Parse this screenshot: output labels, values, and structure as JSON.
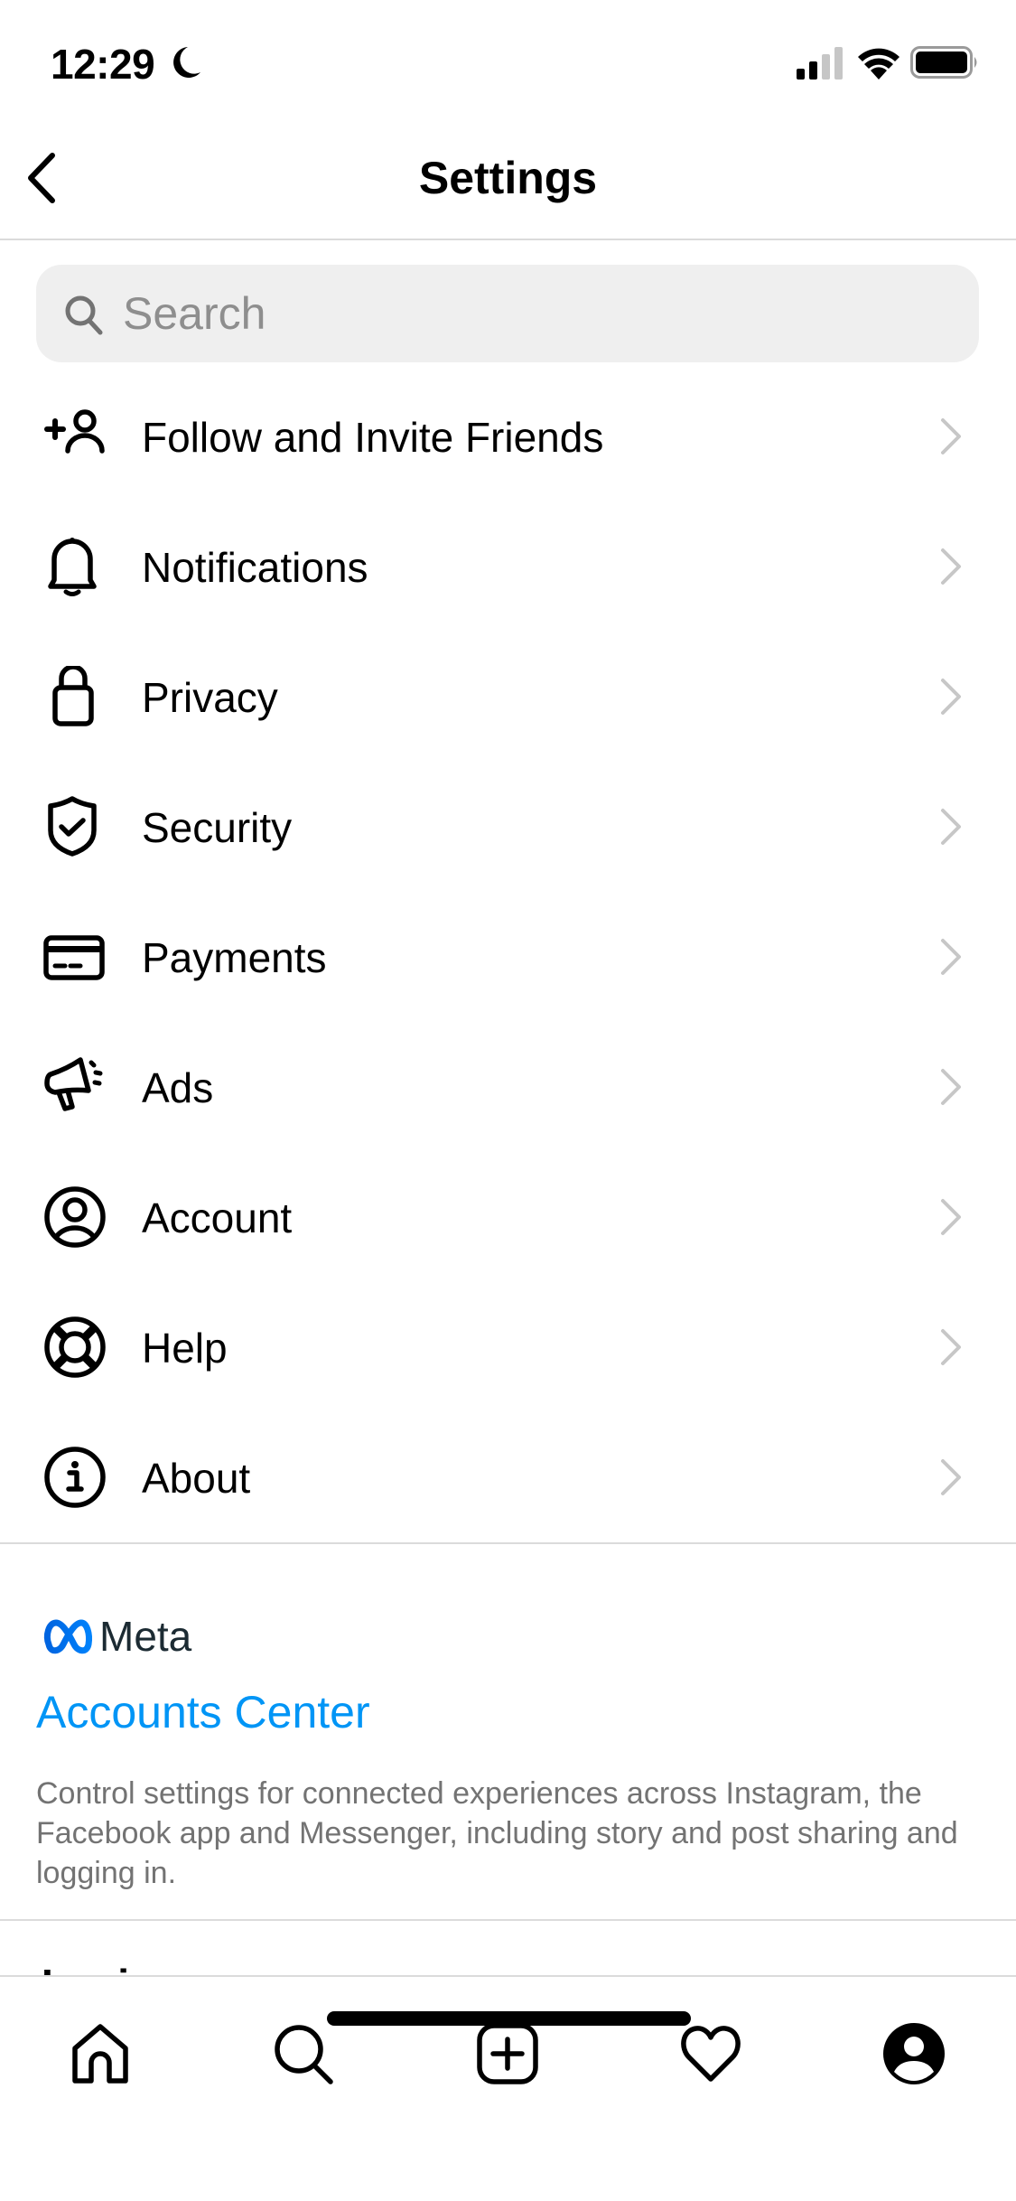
{
  "status_bar": {
    "time": "12:29",
    "focus_mode_icon": "moon-icon",
    "signal_bars_filled": 2,
    "signal_bars_total": 4,
    "wifi": "full",
    "battery_level": 1.0
  },
  "header": {
    "title": "Settings",
    "back_icon": "chevron-left-icon"
  },
  "search": {
    "placeholder": "Search",
    "value": "",
    "icon": "search-icon"
  },
  "menu": {
    "items": [
      {
        "label": "Follow and Invite Friends",
        "icon": "add-person-icon"
      },
      {
        "label": "Notifications",
        "icon": "bell-icon"
      },
      {
        "label": "Privacy",
        "icon": "lock-icon"
      },
      {
        "label": "Security",
        "icon": "shield-check-icon"
      },
      {
        "label": "Payments",
        "icon": "credit-card-icon"
      },
      {
        "label": "Ads",
        "icon": "megaphone-icon"
      },
      {
        "label": "Account",
        "icon": "account-circle-icon"
      },
      {
        "label": "Help",
        "icon": "lifebuoy-icon"
      },
      {
        "label": "About",
        "icon": "info-icon"
      }
    ]
  },
  "meta_section": {
    "brand": "Meta",
    "link_label": "Accounts Center",
    "description": "Control settings for connected experiences across Instagram, the Facebook app and Messenger, including story and post sharing and logging in."
  },
  "next_section": {
    "heading": "Logins"
  },
  "tab_bar": {
    "tabs": [
      {
        "name": "home",
        "icon": "home-icon"
      },
      {
        "name": "search",
        "icon": "search-icon"
      },
      {
        "name": "create",
        "icon": "add-square-icon"
      },
      {
        "name": "activity",
        "icon": "heart-icon"
      },
      {
        "name": "profile",
        "icon": "profile-icon",
        "active": true
      }
    ]
  },
  "colors": {
    "link": "#0095f6",
    "secondary_text": "#737373",
    "placeholder": "#8e8e8e",
    "chevron": "#c7c7c7",
    "divider": "#dbdbdb",
    "search_bg": "#efefef",
    "meta_blue": "#0668e1"
  }
}
